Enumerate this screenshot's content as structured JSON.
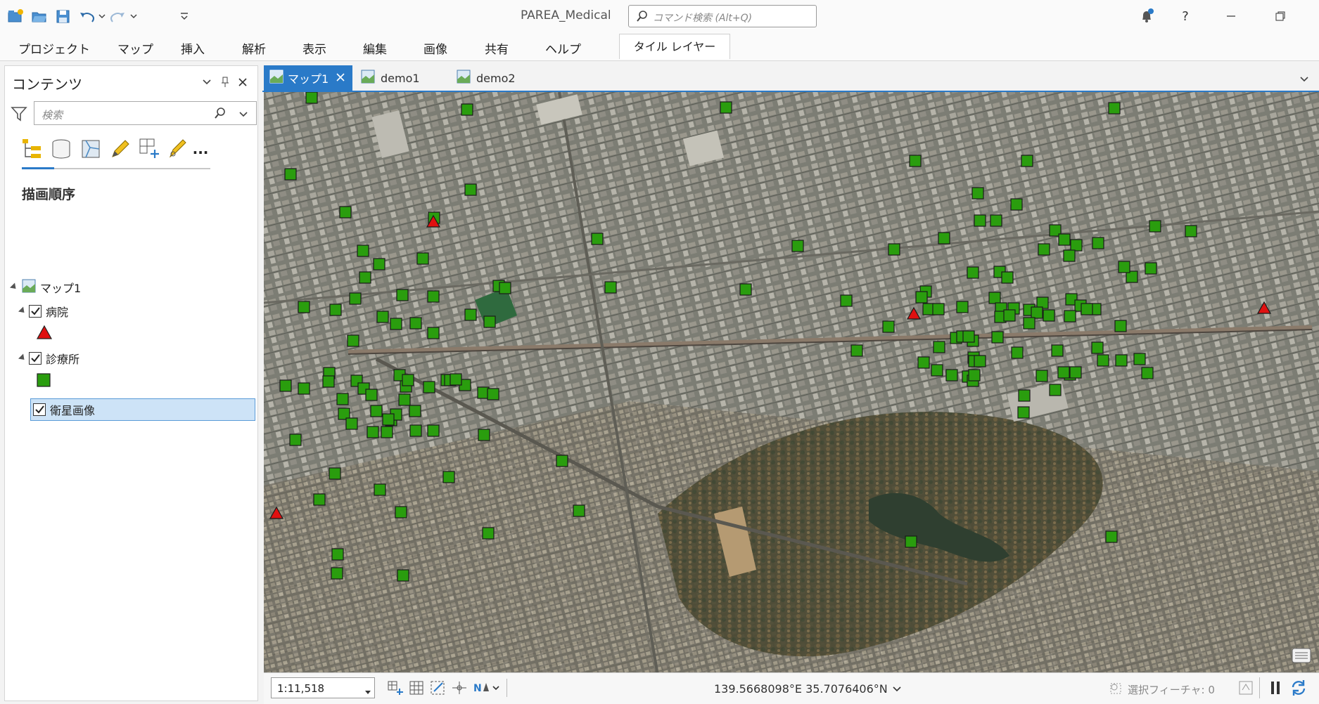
{
  "app": {
    "title": "PAREA_Medical"
  },
  "command_search": {
    "placeholder": "コマンド検索 (Alt+Q)"
  },
  "ribbon": {
    "tabs": [
      "プロジェクト",
      "マップ",
      "挿入",
      "解析",
      "表示",
      "編集",
      "画像",
      "共有",
      "ヘルプ"
    ],
    "contextual_tab": "タイル レイヤー"
  },
  "contents": {
    "title": "コンテンツ",
    "search_placeholder": "検索",
    "more_label": "...",
    "section_title": "描画順序",
    "map_name": "マップ1",
    "layers": [
      {
        "name": "病院",
        "checked": true,
        "symbol": "red-triangle"
      },
      {
        "name": "診療所",
        "checked": true,
        "symbol": "green-square"
      },
      {
        "name": "衛星画像",
        "checked": true,
        "selected": true
      }
    ]
  },
  "map_tabs": [
    {
      "label": "マップ1",
      "active": true
    },
    {
      "label": "demo1",
      "active": false
    },
    {
      "label": "demo2",
      "active": false
    }
  ],
  "status": {
    "scale": "1:11,518",
    "coordinates": "139.5668098°E 35.7076406°N",
    "selected_features": "選択フィーチャ: 0"
  },
  "colors": {
    "accent": "#2a7ac8",
    "clinic_fill": "#2a9d0e",
    "hospital_fill": "#e01010"
  }
}
